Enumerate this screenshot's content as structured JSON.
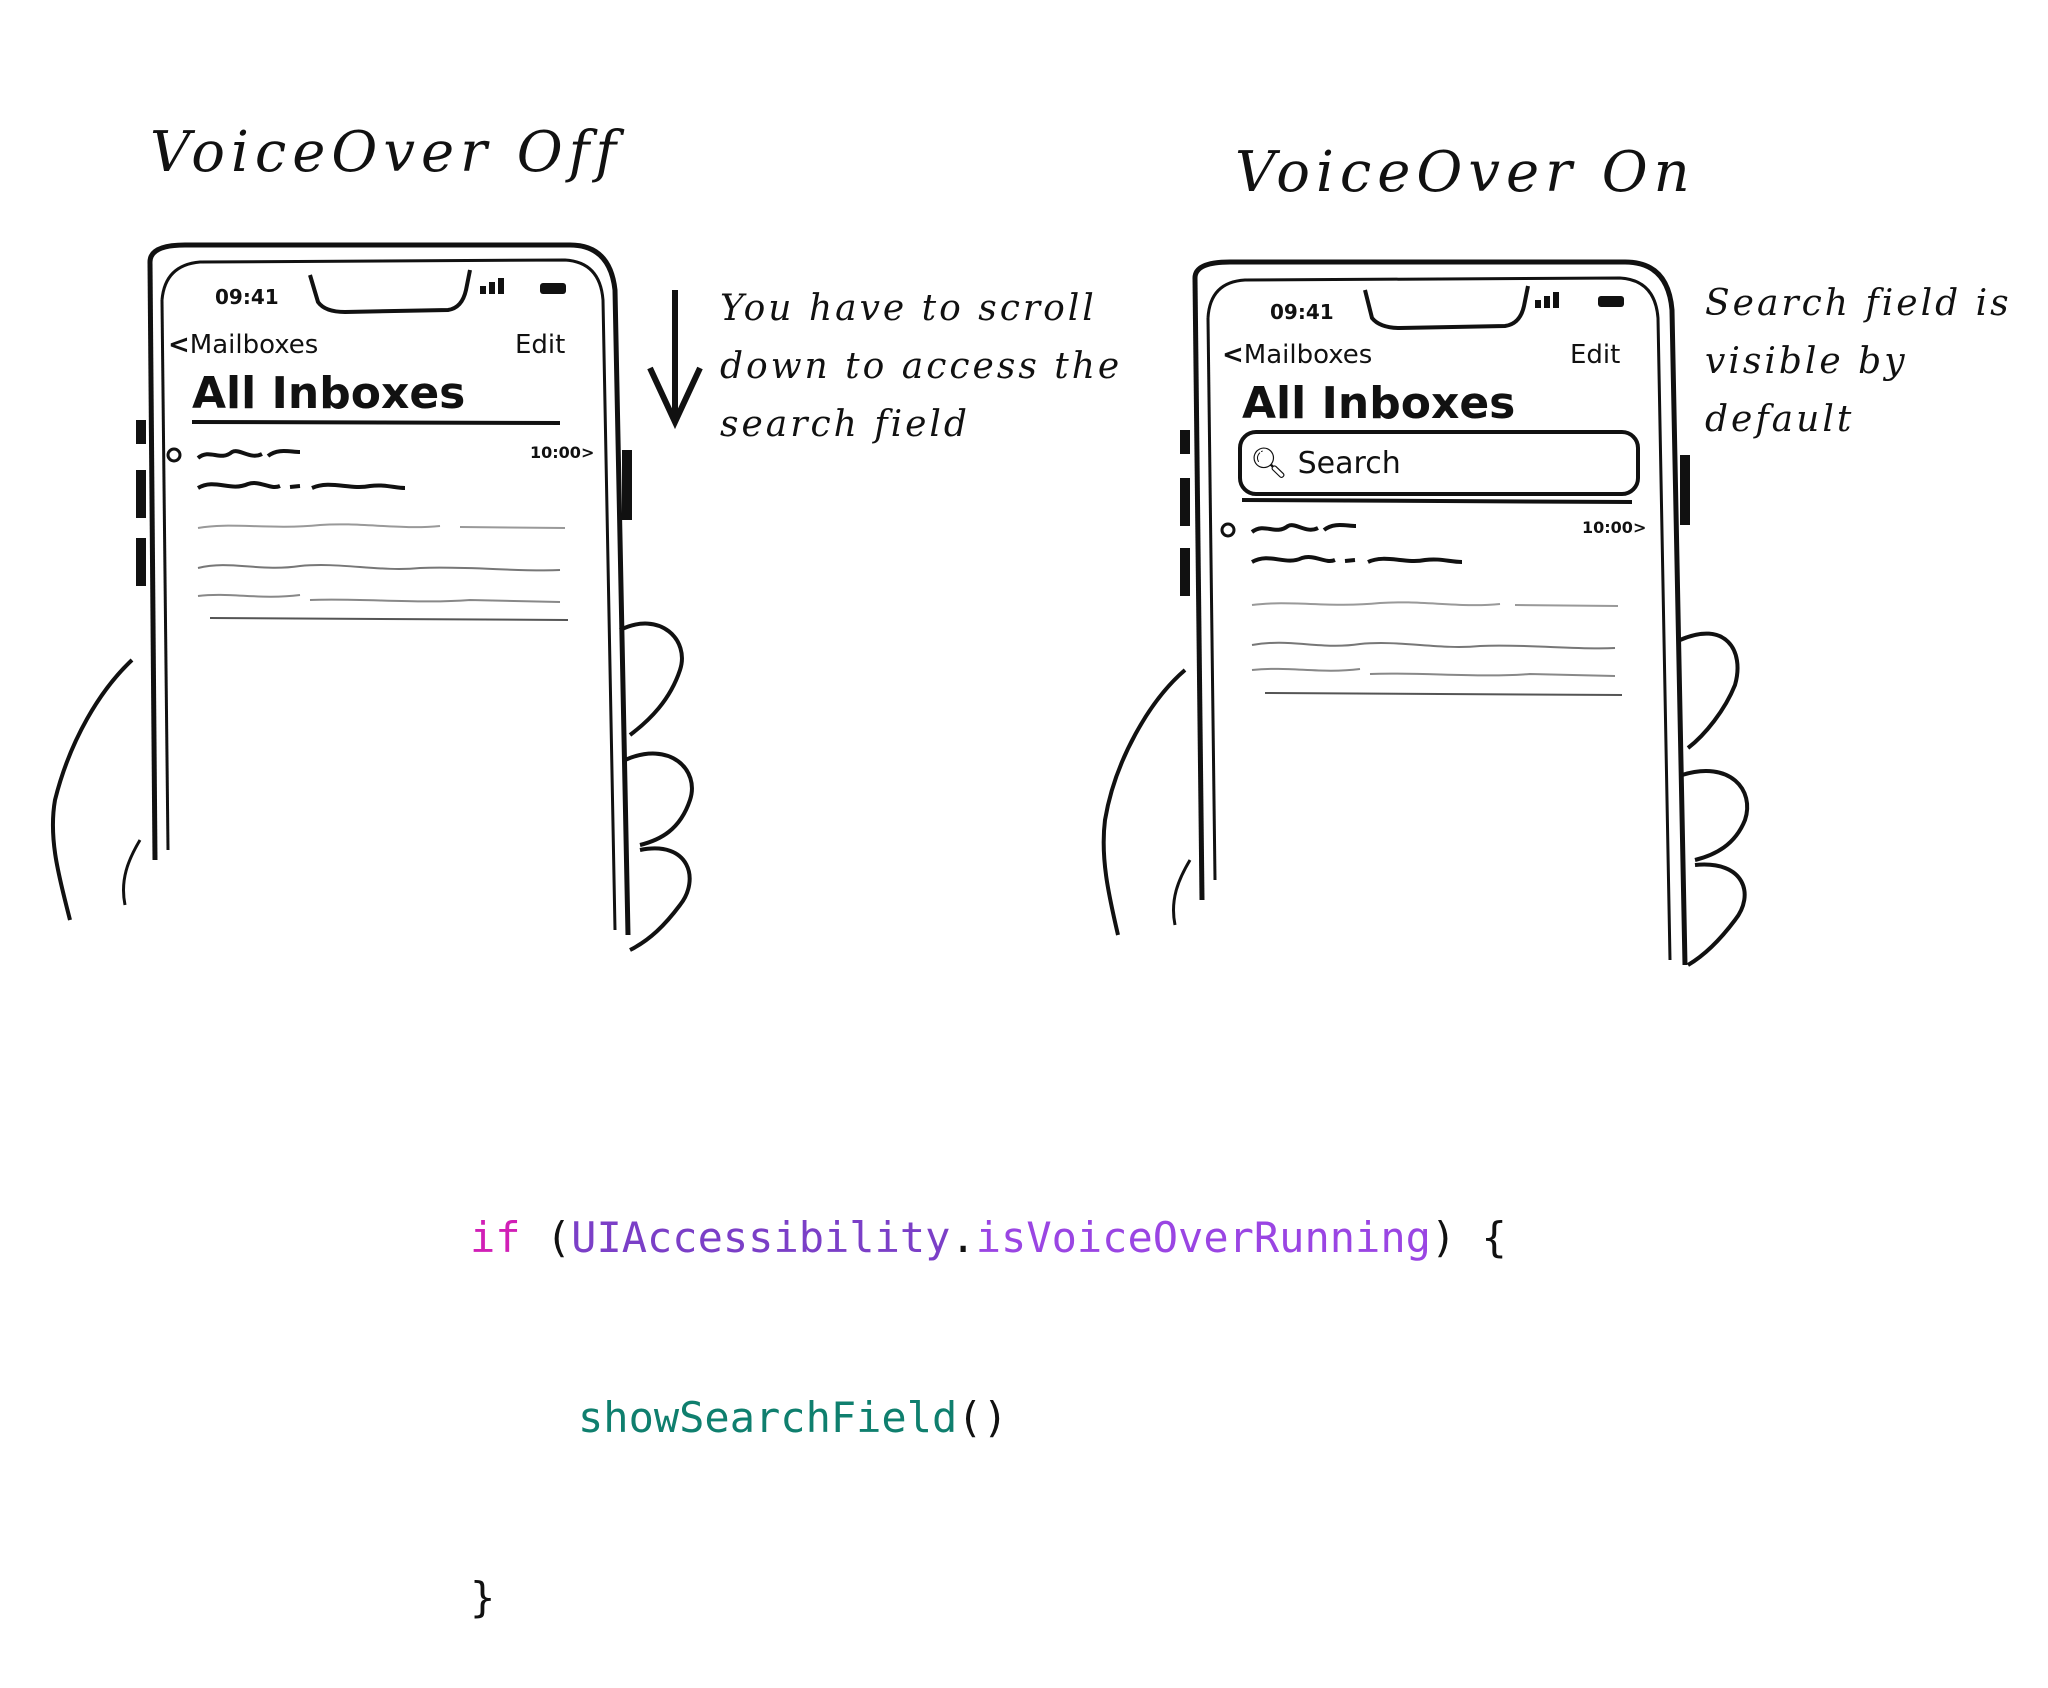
{
  "left": {
    "title": "VoiceOver Off",
    "status_time": "09:41",
    "back_label": "Mailboxes",
    "edit_label": "Edit",
    "heading": "All Inboxes",
    "row_time": "10:00",
    "note": [
      "You have to scroll",
      "down to access the",
      "search field"
    ]
  },
  "right": {
    "title": "VoiceOver On",
    "status_time": "09:41",
    "back_label": "Mailboxes",
    "edit_label": "Edit",
    "heading": "All Inboxes",
    "search_placeholder": "Search",
    "row_time": "10:00",
    "note": [
      "Search field is",
      "visible by",
      "default"
    ]
  },
  "code": {
    "kw_if": "if",
    "open_paren": " (",
    "object": "UIAccessibility",
    "dot": ".",
    "property": "isVoiceOverRunning",
    "close_brace_open": ") {",
    "call": "showSearchField",
    "call_parens": "()",
    "closing": "}"
  },
  "colors": {
    "keyword": "#d11fb6",
    "type": "#7b3fc7",
    "property": "#9a45e3",
    "function": "#0f7f6e",
    "ink": "#111111"
  }
}
